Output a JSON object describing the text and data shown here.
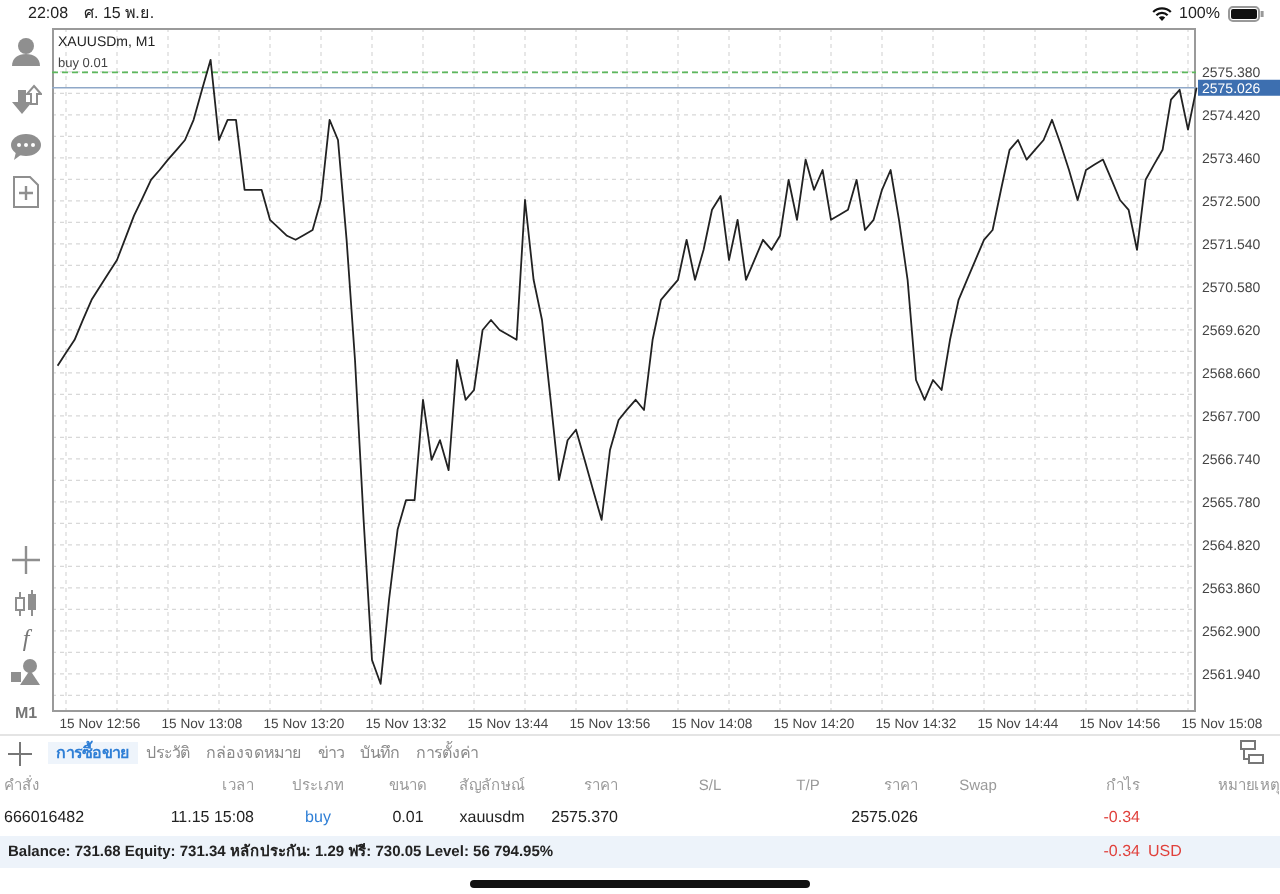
{
  "status_bar": {
    "time": "22:08",
    "date": "ศ. 15 พ.ย.",
    "battery": "100%"
  },
  "toolbar": {
    "function_glyph": "f",
    "timeframe": "M1"
  },
  "chart": {
    "chart_data": {
      "type": "line",
      "title": "XAUUSDm, M1",
      "categories": [
        null,
        null,
        null,
        null,
        null,
        "15 Nov 12:56",
        null,
        null,
        null,
        null,
        null,
        null,
        null,
        null,
        null,
        null,
        null,
        "15 Nov 13:08",
        null,
        null,
        null,
        null,
        null,
        null,
        null,
        null,
        null,
        null,
        null,
        "15 Nov 13:20",
        null,
        null,
        null,
        null,
        null,
        null,
        null,
        null,
        null,
        null,
        null,
        "15 Nov 13:32",
        null,
        null,
        null,
        null,
        null,
        null,
        null,
        null,
        null,
        null,
        null,
        "15 Nov 13:44",
        null,
        null,
        null,
        null,
        null,
        null,
        null,
        null,
        null,
        null,
        null,
        "15 Nov 13:56",
        null,
        null,
        null,
        null,
        null,
        null,
        null,
        null,
        null,
        null,
        null,
        "15 Nov 14:08",
        null,
        null,
        null,
        null,
        null,
        null,
        null,
        null,
        null,
        null,
        null,
        "15 Nov 14:20",
        null,
        null,
        null,
        null,
        null,
        null,
        null,
        null,
        null,
        null,
        null,
        "15 Nov 14:32",
        null,
        null,
        null,
        null,
        null,
        null,
        null,
        null,
        null,
        null,
        null,
        "15 Nov 14:44",
        null,
        null,
        null,
        null,
        null,
        null,
        null,
        null,
        null,
        null,
        null,
        "15 Nov 14:56",
        null,
        null,
        null,
        null,
        null,
        null,
        null,
        null,
        null,
        null,
        null,
        "15 Nov 15:08"
      ],
      "series": [
        {
          "color": "#222222",
          "values": [
            2568.82,
            2569.11,
            2569.4,
            2569.85,
            2570.29,
            2570.59,
            2570.89,
            2571.18,
            2571.68,
            2572.17,
            2572.57,
            2572.97,
            2573.19,
            2573.42,
            2573.64,
            2573.86,
            2574.31,
            2574.98,
            2575.65,
            2573.86,
            2574.31,
            2574.31,
            2572.75,
            2572.75,
            2572.75,
            2572.08,
            2571.9,
            2571.72,
            2571.63,
            2571.74,
            2571.85,
            2572.52,
            2574.31,
            2573.86,
            2571.63,
            2568.95,
            2565.38,
            2562.25,
            2561.72,
            2563.59,
            2565.16,
            2565.82,
            2565.82,
            2568.06,
            2566.72,
            2567.16,
            2566.49,
            2568.95,
            2568.06,
            2568.28,
            2569.62,
            2569.84,
            2569.62,
            2569.51,
            2569.4,
            2572.52,
            2570.74,
            2569.84,
            2568.06,
            2566.27,
            2567.16,
            2567.39,
            2566.72,
            2566.05,
            2565.38,
            2566.94,
            2567.61,
            2567.84,
            2568.06,
            2567.83,
            2569.4,
            2570.29,
            2570.52,
            2570.74,
            2571.63,
            2570.74,
            2571.41,
            2572.3,
            2572.61,
            2571.18,
            2572.08,
            2570.74,
            2571.19,
            2571.63,
            2571.41,
            2571.72,
            2572.97,
            2572.08,
            2573.42,
            2572.75,
            2573.19,
            2572.08,
            2572.19,
            2572.3,
            2572.97,
            2571.85,
            2572.08,
            2572.75,
            2573.19,
            2572.08,
            2570.74,
            2568.5,
            2568.06,
            2568.5,
            2568.28,
            2569.4,
            2570.29,
            2570.74,
            2571.19,
            2571.63,
            2571.85,
            2572.75,
            2573.64,
            2573.86,
            2573.42,
            2573.64,
            2573.86,
            2574.31,
            2573.77,
            2573.19,
            2572.52,
            2573.19,
            2573.31,
            2573.42,
            2572.97,
            2572.52,
            2572.3,
            2571.41,
            2572.97,
            2573.31,
            2573.64,
            2574.76,
            2574.98,
            2574.09,
            2575.03,
            null,
            null,
            null
          ]
        }
      ],
      "ylim": [
        2561.09,
        2576.36
      ],
      "grid": true,
      "ref_lines": [
        {
          "axis": "y",
          "value": 2575.37,
          "label": "buy 0.01",
          "color": "#5cb85c"
        },
        {
          "axis": "y",
          "value": 2575.026,
          "label": "2575.026",
          "color": "#8fa8c8"
        }
      ],
      "yticks": [
        {
          "value": 2575.38,
          "label": "2575.380"
        },
        {
          "value": 2574.42,
          "label": "2574.420"
        },
        {
          "value": 2573.46,
          "label": "2573.460"
        },
        {
          "value": 2572.5,
          "label": "2572.500"
        },
        {
          "value": 2571.54,
          "label": "2571.540"
        },
        {
          "value": 2570.58,
          "label": "2570.580"
        },
        {
          "value": 2569.62,
          "label": "2569.620"
        },
        {
          "value": 2568.66,
          "label": "2568.660"
        },
        {
          "value": 2567.7,
          "label": "2567.700"
        },
        {
          "value": 2566.74,
          "label": "2566.740"
        },
        {
          "value": 2565.78,
          "label": "2565.780"
        },
        {
          "value": 2564.82,
          "label": "2564.820"
        },
        {
          "value": 2563.86,
          "label": "2563.860"
        },
        {
          "value": 2562.9,
          "label": "2562.900"
        },
        {
          "value": 2561.94,
          "label": "2561.940"
        }
      ]
    }
  },
  "tabs": [
    {
      "label": "การซื้อขาย",
      "selected": true
    },
    {
      "label": "ประวัติ",
      "selected": false
    },
    {
      "label": "กล่องจดหมาย",
      "selected": false
    },
    {
      "label": "ข่าว",
      "selected": false
    },
    {
      "label": "บันทึก",
      "selected": false
    },
    {
      "label": "การตั้งค่า",
      "selected": false
    }
  ],
  "table": {
    "columns": [
      "คำสั่ง",
      "เวลา",
      "ประเภท",
      "ขนาด",
      "สัญลักษณ์",
      "ราคา",
      "S/L",
      "T/P",
      "ราคา",
      "Swap",
      "กำไร",
      "หมายเหตุ"
    ],
    "rows": [
      {
        "order": "666016482",
        "time": "11.15 15:08",
        "type": "buy",
        "volume": "0.01",
        "symbol": "xauusdm",
        "open_price": "2575.370",
        "current_price": "2575.026",
        "profit": "-0.34"
      }
    ],
    "summary": {
      "text": "Balance: 731.68 Equity: 731.34 หลักประกัน: 1.29 ฟรี: 730.05 Level: 56 794.95%",
      "profit": "-0.34",
      "currency": "USD"
    }
  }
}
